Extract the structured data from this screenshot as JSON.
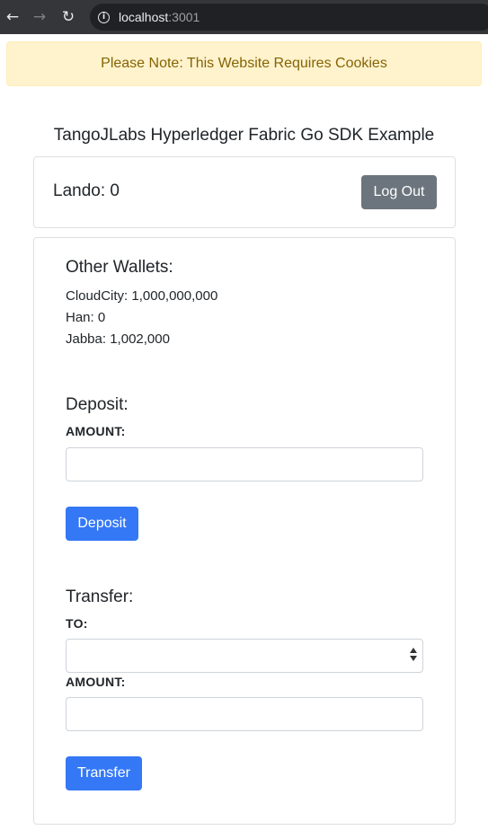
{
  "browser": {
    "url_host": "localhost",
    "url_port": ":3001",
    "back_icon": "←",
    "forward_icon": "→",
    "reload_icon": "↻",
    "info_icon": "i"
  },
  "alert": {
    "text": "Please Note: This Website Requires Cookies"
  },
  "header": {
    "title": "TangoJLabs Hyperledger Fabric Go SDK Example"
  },
  "user": {
    "name": "Lando",
    "balance": "0",
    "logout_label": "Log Out"
  },
  "other_wallets": {
    "heading": "Other Wallets:",
    "items": [
      {
        "name": "CloudCity",
        "balance": "1,000,000,000"
      },
      {
        "name": "Han",
        "balance": "0"
      },
      {
        "name": "Jabba",
        "balance": "1,002,000"
      }
    ]
  },
  "deposit": {
    "heading": "Deposit:",
    "amount_label": "AMOUNT:",
    "amount_value": "",
    "button_label": "Deposit"
  },
  "transfer": {
    "heading": "Transfer:",
    "to_label": "TO:",
    "to_value": "",
    "amount_label": "AMOUNT:",
    "amount_value": "",
    "button_label": "Transfer"
  },
  "colors": {
    "primary": "#3478f6",
    "secondary": "#6c757d",
    "alert_bg": "#fff3cd",
    "alert_text": "#856404"
  }
}
